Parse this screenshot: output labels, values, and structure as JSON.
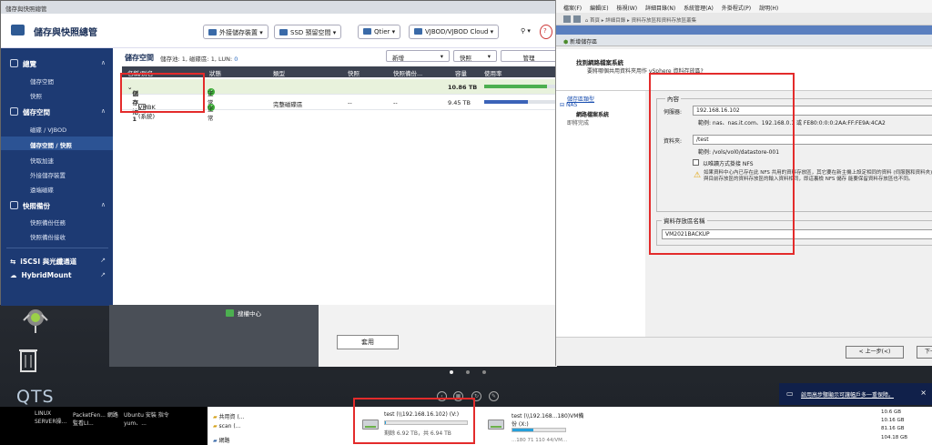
{
  "qnap": {
    "window_title": "儲存與快照總管",
    "app_title": "儲存與快照總管",
    "header_buttons": [
      "外接儲存裝置",
      "SSD 預留空間",
      "Qtier",
      "VJBOD/VJBOD Cloud"
    ],
    "sidebar": {
      "sections": [
        {
          "label": "總覽",
          "items": [
            "儲存空間",
            "快照"
          ]
        },
        {
          "label": "儲存空間",
          "items": [
            "磁碟 / VJBOD",
            "儲存空間 / 快照",
            "快取加速",
            "外接儲存裝置",
            "遠端磁碟"
          ]
        },
        {
          "label": "快照備份",
          "items": [
            "快照備份任務",
            "快照備份接收"
          ]
        }
      ],
      "links": [
        "iSCSI 與光纖通道",
        "HybridMount"
      ],
      "active_item": "儲存空間 / 快照"
    },
    "content": {
      "title": "儲存空間",
      "summary_prefix": "儲存池: 1, 磁碟區: 1, LUN:",
      "summary_lun": "0",
      "buttons": [
        "新增",
        "快照",
        "管理"
      ],
      "columns": [
        "名稱/別名",
        "狀態",
        "類型",
        "快照",
        "快照備份...",
        "容量",
        "使用率"
      ],
      "rows": [
        {
          "name": "儲存池 1",
          "status": "正常",
          "type": "",
          "snapshot": "",
          "backup": "",
          "capacity": "10.86 TB",
          "usage": 0.88,
          "color": "#4caf50"
        },
        {
          "name": "VMBK (系統)",
          "status": "正常",
          "type": "完整磁碟區",
          "snapshot": "--",
          "backup": "--",
          "capacity": "9.45 TB",
          "usage": 0.62,
          "color": "#3b63b8"
        }
      ]
    },
    "bottom": {
      "monitor_label": "搜權中心",
      "apply_label": "套用"
    }
  },
  "desktop": {
    "qts_logo": "QTS"
  },
  "vsphere": {
    "menu": [
      "檔案(F)",
      "編輯(E)",
      "檢視(W)",
      "詳細目錄(N)",
      "系統管理(A)",
      "外掛程式(P)",
      "說明(H)"
    ],
    "toolbar": [
      "首頁",
      "詳細目錄",
      "資料存放區和資料存放區叢集"
    ],
    "wizard_title": "新增儲存區",
    "heading": "找到網路檔案系統",
    "subheading": "要將哪個共用資料夾用作 vSphere 資料存放區?",
    "nav": [
      "儲存區類型",
      "NAS",
      "網路檔案系統",
      "即將完成"
    ],
    "group_properties": "內容",
    "server_label": "伺服器:",
    "server_value": "192.168.16.102",
    "server_example": "範例: nas、nas.it.com、192.168.0.1 或 FE80:0:0:0:2AA:FF:FE9A:4CA2",
    "folder_label": "資料夾:",
    "folder_value": "/test",
    "folder_example": "範例: /vols/vol0/datastore-001",
    "readonly_label": "以唯讀方式掛接 NFS",
    "warning": "如果資料中心內已存在此 NFS 共用的資料存放區，其它要在新主機上設定相同的資料 (伺服器和資料夾) 與目前存放區的資料存放區的輸入資料相同，即這裏檢 NFS 儲存 能要保留資料存放區也不同。",
    "group_name": "資料存放區名稱",
    "name_value": "VM2021BACKUP",
    "back_btn": "< 上一步(<)",
    "next_btn": "下一"
  },
  "taskbar": {
    "items": [
      "LINUX SERVER操...",
      "PacketFen... 網路監看LI...",
      "Ubuntu 安裝 指令 yum、..."
    ],
    "explorer_folders": [
      "共用資 (...",
      "scan (...",
      "網路"
    ],
    "drive1_name": "test (\\\\192.168.16.102) (V:)",
    "drive1_free": "剩餘 6.92 TB，共 6.94 TB",
    "drive1_usage": 0.01,
    "drive2_name": "test (\\\\192.168...180)VM備份 (X:)",
    "drive2_sub": "...180 71 110 44/VM...",
    "drive2_usage": 0.4,
    "sizes": [
      "10.6 GB",
      "10.16 GB",
      "81.16 GB",
      "104.18 GB"
    ],
    "toast": "啟用高步驟顯示可讓幅戶多一重保障。"
  }
}
